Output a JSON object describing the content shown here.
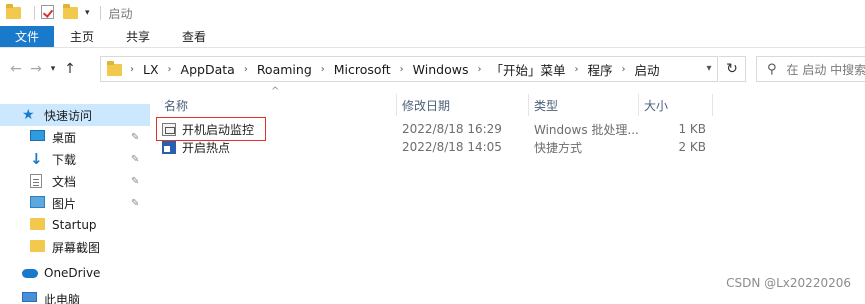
{
  "window": {
    "title": "启动"
  },
  "ribbon": {
    "tabs": [
      "文件",
      "主页",
      "共享",
      "查看"
    ]
  },
  "address": {
    "crumbs": [
      "LX",
      "AppData",
      "Roaming",
      "Microsoft",
      "Windows",
      "「开始」菜单",
      "程序",
      "启动"
    ]
  },
  "search": {
    "placeholder": "在 启动 中搜索"
  },
  "nav": {
    "quick_access": "快速访问",
    "items": [
      {
        "label": "桌面",
        "pinned": true
      },
      {
        "label": "下载",
        "pinned": true
      },
      {
        "label": "文档",
        "pinned": true
      },
      {
        "label": "图片",
        "pinned": true
      },
      {
        "label": "Startup",
        "pinned": false
      },
      {
        "label": "屏幕截图",
        "pinned": false
      }
    ],
    "onedrive": "OneDrive",
    "this_pc": "此电脑"
  },
  "columns": {
    "name": "名称",
    "modified": "修改日期",
    "type": "类型",
    "size": "大小"
  },
  "files": [
    {
      "name": "开机启动监控",
      "modified": "2022/8/18 16:29",
      "type": "Windows 批处理...",
      "size": "1 KB",
      "icon": "batch-file-icon"
    },
    {
      "name": "开启热点",
      "modified": "2022/8/18 14:05",
      "type": "快捷方式",
      "size": "2 KB",
      "icon": "shortcut-icon"
    }
  ],
  "watermark": "CSDN @Lx20220206",
  "colors": {
    "accent": "#1979ca",
    "selection": "#cce8ff",
    "highlight_box": "#e3322b"
  }
}
